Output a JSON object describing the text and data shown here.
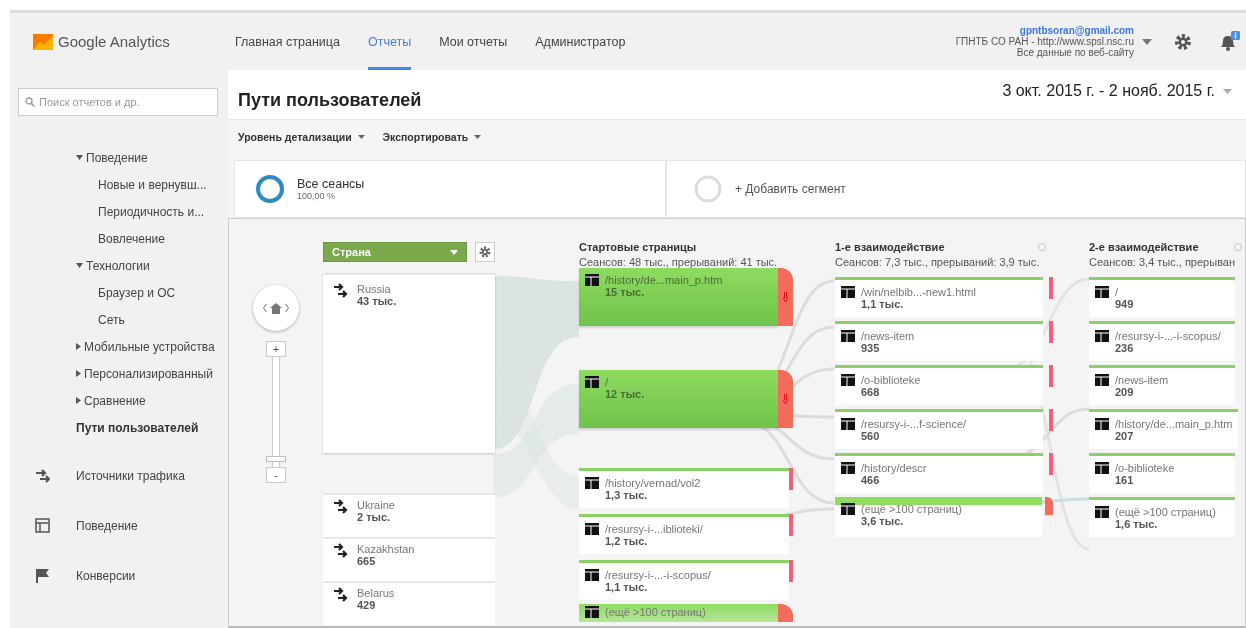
{
  "header": {
    "logo": "Google Analytics",
    "nav": [
      {
        "label": "Главная страница",
        "selected": false
      },
      {
        "label": "Отчеты",
        "selected": true
      },
      {
        "label": "Мои отчеты",
        "selected": false
      },
      {
        "label": "Администратор",
        "selected": false
      }
    ],
    "account": {
      "email": "gpntbsoran@gmail.com",
      "property": "ГПНТБ СО РАН - http://www.spsl.nsc.ru",
      "view": "Все данные по веб-сайту"
    }
  },
  "sidebar": {
    "search": {
      "placeholder": "Поиск отчетов и др."
    },
    "items": [
      {
        "label": "Поведение",
        "expanded": true,
        "selected": false,
        "children": [
          {
            "label": "Новые и вернувш...",
            "selected": false
          },
          {
            "label": "Периодичность и...",
            "selected": false
          },
          {
            "label": "Вовлечение",
            "selected": false
          }
        ]
      },
      {
        "label": "Технологии",
        "expanded": true,
        "selected": false,
        "children": [
          {
            "label": "Браузер и ОС",
            "selected": false
          },
          {
            "label": "Сеть",
            "selected": false
          }
        ]
      },
      {
        "label": "Мобильные устройства",
        "expanded": false,
        "selected": false
      },
      {
        "label": "Персонализированный",
        "expanded": false,
        "selected": false
      },
      {
        "label": "Сравнение",
        "expanded": false,
        "selected": false
      },
      {
        "label": "Пути пользователей",
        "selected": true
      }
    ],
    "sections": [
      {
        "label": "Источники трафика",
        "kind": "traffic"
      },
      {
        "label": "Поведение",
        "kind": "behavior"
      },
      {
        "label": "Конверсии",
        "kind": "conversions"
      }
    ]
  },
  "report": {
    "title": "Пути пользователей",
    "date_range": "3 окт. 2015 г. - 2 нояб. 2015 г.",
    "toolbar": [
      "Уровень детализации",
      "Экспортировать"
    ],
    "segments": [
      {
        "kind": "active",
        "name": "Все сеансы",
        "share": "100,00 %"
      },
      {
        "kind": "add",
        "name": "+ Добавить сегмент"
      }
    ]
  },
  "flow": {
    "zoom": {
      "zoom_in": "+",
      "zoom_out": "-",
      "level": 0.05
    },
    "dimension": "Страна",
    "countries": [
      {
        "name": "Russia",
        "value": "43 тыс.",
        "kind": "large"
      },
      {
        "name": "Ukraine",
        "value": "2 тыс.",
        "kind": "small"
      },
      {
        "name": "Kazakhstan",
        "value": "665",
        "kind": "small"
      },
      {
        "name": "Belarus",
        "value": "429",
        "kind": "small"
      }
    ],
    "columns": [
      {
        "title": "Стартовые страницы",
        "summary": "Сеансов: 48 тыс., прерываний: 41 тыс.",
        "closable": false,
        "nodes": [
          {
            "page": "/history/de...main_p.htm",
            "value": "15 тыс.",
            "kind": "large",
            "dropoff": true
          },
          {
            "page": "/",
            "value": "12 тыс.",
            "kind": "large",
            "dropoff": true
          },
          {
            "page": "/history/vernad/vol2",
            "value": "1,3 тыс.",
            "kind": "small",
            "dropoff": true
          },
          {
            "page": "/resursy-i-...iblioteki/",
            "value": "1,2 тыс.",
            "kind": "small",
            "dropoff": true
          },
          {
            "page": "/resursy-i-...-i-scopus/",
            "value": "1,1 тыс.",
            "kind": "small",
            "dropoff": true
          },
          {
            "page": "(ещё >100 страниц)",
            "kind": "cut",
            "dropoff": true
          }
        ]
      },
      {
        "title": "1-е взаимодействие",
        "summary": "Сеансов: 7,3 тыс., прерываний: 3,9 тыс.",
        "closable": true,
        "nodes": [
          {
            "page": "/win/nelbib...-new1.html",
            "value": "1,1 тыс.",
            "kind": "small",
            "dropoff": true
          },
          {
            "page": "/news-item",
            "value": "935",
            "kind": "small",
            "dropoff": true
          },
          {
            "page": "/o-biblioteke",
            "value": "668",
            "kind": "small",
            "dropoff": true
          },
          {
            "page": "/resursy-i-...f-science/",
            "value": "560",
            "kind": "small",
            "dropoff": true
          },
          {
            "page": "/history/descr",
            "value": "466",
            "kind": "small",
            "dropoff": true
          },
          {
            "page": "(ещё >100 страниц)",
            "value": "3,6 тыс.",
            "kind": "more",
            "dropoff": true
          }
        ]
      },
      {
        "title": "2-е взаимодействие",
        "summary": "Сеансов: 3,4 тыс., прерыван",
        "closable": true,
        "nodes": [
          {
            "page": "/",
            "value": "949",
            "kind": "small"
          },
          {
            "page": "/resursy-i-...-i-scopus/",
            "value": "236",
            "kind": "small"
          },
          {
            "page": "/news-item",
            "value": "209",
            "kind": "small"
          },
          {
            "page": "/history/de...main_p.htm",
            "value": "207",
            "kind": "small"
          },
          {
            "page": "/o-biblioteke",
            "value": "161",
            "kind": "small"
          },
          {
            "page": "(ещё >100 страниц)",
            "value": "1,6 тыс.",
            "kind": "small"
          }
        ]
      }
    ]
  }
}
